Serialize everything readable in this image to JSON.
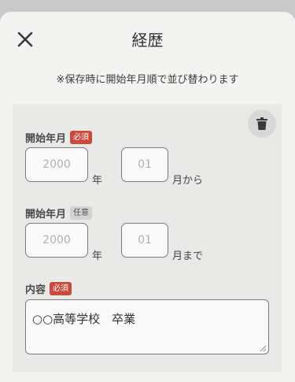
{
  "modal": {
    "title": "経歴",
    "note": "※保存時に開始年月順で並び替わります"
  },
  "entry": {
    "start": {
      "label": "開始年月",
      "badge": "必須",
      "year_placeholder": "2000",
      "year_unit": "年",
      "month_placeholder": "01",
      "month_unit": "月から"
    },
    "end": {
      "label": "開始年月",
      "badge": "任意",
      "year_placeholder": "2000",
      "year_unit": "年",
      "month_placeholder": "01",
      "month_unit": "月まで"
    },
    "content": {
      "label": "内容",
      "badge": "必須",
      "value": "○○高等学校　卒業"
    }
  },
  "icons": {
    "close": "close-icon",
    "delete": "trash-icon"
  },
  "colors": {
    "required_badge": "#c94a3d",
    "optional_badge": "#d3d3d1",
    "background": "#f3f3f1"
  }
}
